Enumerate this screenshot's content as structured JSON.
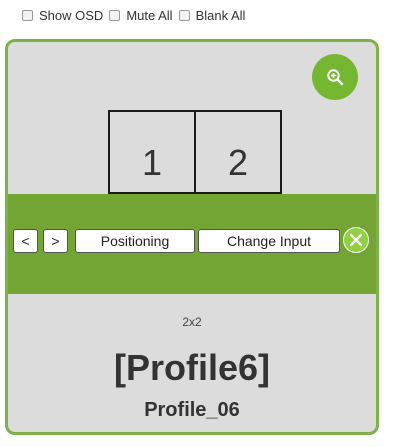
{
  "options": {
    "show_osd": "Show OSD",
    "mute_all": "Mute All",
    "blank_all": "Blank All"
  },
  "card": {
    "cells": [
      "1",
      "2"
    ],
    "buttons": {
      "prev": "<",
      "next": ">",
      "positioning": "Positioning",
      "change_input": "Change Input"
    },
    "layout": "2x2",
    "profile_title": "[Profile6]",
    "profile_name": "Profile_06"
  },
  "colors": {
    "accent": "#76b730",
    "band": "#73a535",
    "border": "#7cb342",
    "card_bg": "#dcdcdc"
  },
  "icons": {
    "zoom": "zoom-in-icon",
    "close": "close-icon"
  }
}
